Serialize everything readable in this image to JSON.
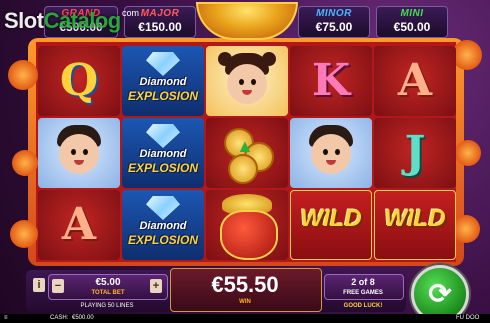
{
  "watermark": {
    "slot": "Slot",
    "catalog": "Catalog",
    "com": "com"
  },
  "jackpots": [
    {
      "name": "GRAND",
      "value": "€500.00",
      "color": "#ff4a4a"
    },
    {
      "name": "MAJOR",
      "value": "€150.00",
      "color": "#ff5a5a"
    },
    {
      "name": "MINOR",
      "value": "€75.00",
      "color": "#4ab7ff"
    },
    {
      "name": "MINI",
      "value": "€50.00",
      "color": "#44dd55"
    }
  ],
  "reels": {
    "col1": [
      "Q",
      "boy",
      "A"
    ],
    "col2": [
      "diamond",
      "diamond",
      "diamond"
    ],
    "col3": [
      "girl",
      "coins",
      "pot"
    ],
    "col4": [
      "K",
      "boy",
      "WILD"
    ],
    "col5": [
      "A",
      "J",
      "WILD"
    ],
    "diamond_line1": "Diamond",
    "diamond_line2": "EXPLOSION",
    "wild_label": "WILD"
  },
  "bet": {
    "value": "€5.00",
    "label": "TOTAL BET",
    "lines": "PLAYING 50 LINES",
    "minus": "−",
    "plus": "+",
    "info": "i"
  },
  "win": {
    "value": "€55.50",
    "label": "WIN"
  },
  "free_games": {
    "counter": "2 of 8",
    "label": "FREE GAMES",
    "message": "GOOD LUCK!"
  },
  "status": {
    "cash_label": "CASH:",
    "cash_value": "€500.00",
    "game_name": "FU DOO"
  },
  "colors": {
    "frame": "#d4471a",
    "reel_bg": "#b2171a",
    "spin": "#1c8c1c"
  }
}
